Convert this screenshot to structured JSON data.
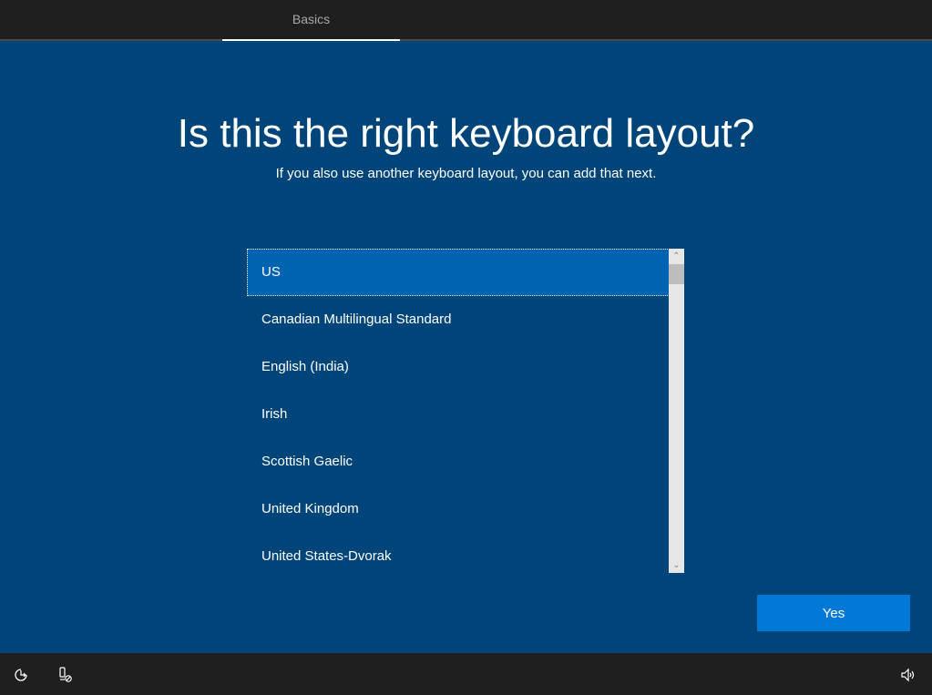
{
  "header": {
    "tabs": [
      {
        "label": "Basics",
        "active": true
      }
    ]
  },
  "main": {
    "title": "Is this the right keyboard layout?",
    "subtitle": "If you also use another keyboard layout, you can add that next.",
    "layouts": [
      {
        "label": "US",
        "selected": true
      },
      {
        "label": "Canadian Multilingual Standard"
      },
      {
        "label": "English (India)"
      },
      {
        "label": "Irish"
      },
      {
        "label": "Scottish Gaelic"
      },
      {
        "label": "United Kingdom"
      },
      {
        "label": "United States-Dvorak"
      }
    ],
    "yes_label": "Yes"
  },
  "footer": {
    "icons": [
      "ease-of-access-icon",
      "microphone-off-icon",
      "volume-icon"
    ]
  }
}
